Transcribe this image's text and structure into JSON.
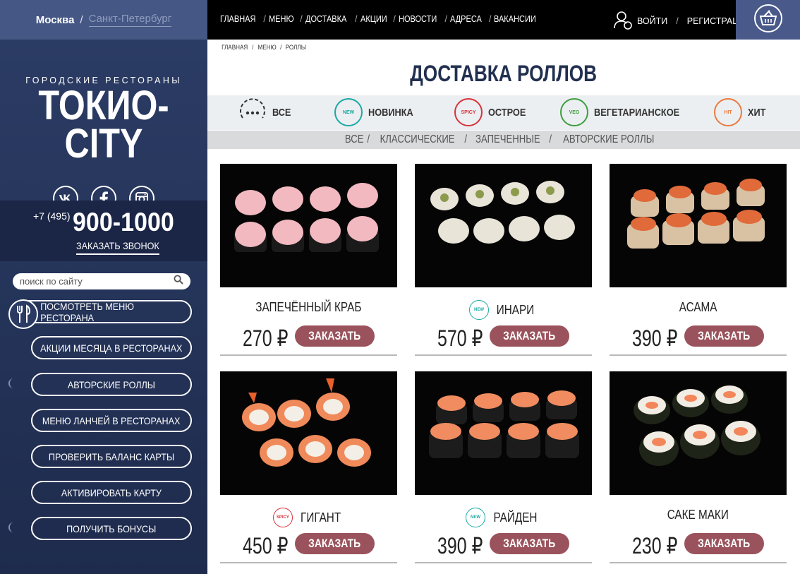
{
  "sidebar": {
    "cities": {
      "active": "Москва",
      "separator": "/",
      "other": "Санкт-Петербург"
    },
    "brand_sub": "ГОРОДСКИЕ РЕСТОРАНЫ",
    "brand_title": "ТОКИО-CITY",
    "phone_code": "+7 (495)",
    "phone_number": "900-1000",
    "callback": "ЗАКАЗАТЬ ЗВОНОК",
    "search_placeholder": "поиск по сайту",
    "buttons": [
      "ПОСМОТРЕТЬ МЕНЮ РЕСТОРАНА",
      "АКЦИИ МЕСЯЦА В РЕСТОРАНАХ",
      "АВТОРСКИЕ РОЛЛЫ",
      "МЕНЮ ЛАНЧЕЙ В РЕСТОРАНАХ",
      "ПРОВЕРИТЬ БАЛАНС КАРТЫ",
      "АКТИВИРОВАТЬ КАРТУ",
      "ПОЛУЧИТЬ БОНУСЫ"
    ]
  },
  "nav": {
    "links": [
      "ГЛАВНАЯ",
      "МЕНЮ",
      "ДОСТАВКА",
      "АКЦИИ",
      "НОВОСТИ",
      "АДРЕСА",
      "ВАКАНСИИ"
    ],
    "separator": "/",
    "login": "ВОЙТИ",
    "register": "РЕГИСТРАЦИЯ"
  },
  "breadcrumb": [
    "ГЛАВНАЯ",
    "/",
    "МЕНЮ",
    "/",
    "РОЛЛЫ"
  ],
  "page_title": "ДОСТАВКА РОЛЛОВ",
  "filters": [
    {
      "label": "ВСЕ",
      "badge": "",
      "color": "#333333"
    },
    {
      "label": "НОВИНКА",
      "badge": "NEW",
      "color": "#1aa9a3"
    },
    {
      "label": "ОСТРОЕ",
      "badge": "SPICY",
      "color": "#d8333b"
    },
    {
      "label": "ВЕГЕТАРИАНСКОЕ",
      "badge": "VEG",
      "color": "#3e9e3c"
    },
    {
      "label": "ХИТ",
      "badge": "HIT",
      "color": "#e97a3f"
    }
  ],
  "subcategories": [
    "ВСЕ",
    "КЛАССИЧЕСКИЕ",
    "ЗАПЕЧЕННЫЕ",
    "АВТОРСКИЕ РОЛЛЫ"
  ],
  "subcat_separator": "/",
  "order_label": "ЗАКАЗАТЬ",
  "products": [
    {
      "name": "ЗАПЕЧЁННЫЙ КРАБ",
      "price": "270 ₽",
      "badge": "",
      "badge_color": ""
    },
    {
      "name": "ИНАРИ",
      "price": "570 ₽",
      "badge": "NEW",
      "badge_color": "#1aa9a3"
    },
    {
      "name": "АСАМА",
      "price": "390 ₽",
      "badge": "",
      "badge_color": ""
    },
    {
      "name": "ГИГАНТ",
      "price": "450 ₽",
      "badge": "SPICY",
      "badge_color": "#d8333b"
    },
    {
      "name": "РАЙДЕН",
      "price": "390 ₽",
      "badge": "NEW",
      "badge_color": "#1aa9a3"
    },
    {
      "name": "САКЕ МАКИ",
      "price": "230 ₽",
      "badge": "",
      "badge_color": ""
    }
  ],
  "colors": {
    "sidebar": "#2c3d66",
    "city_bar": "#455784",
    "order_button": "#9a535c",
    "title": "#22304f"
  }
}
